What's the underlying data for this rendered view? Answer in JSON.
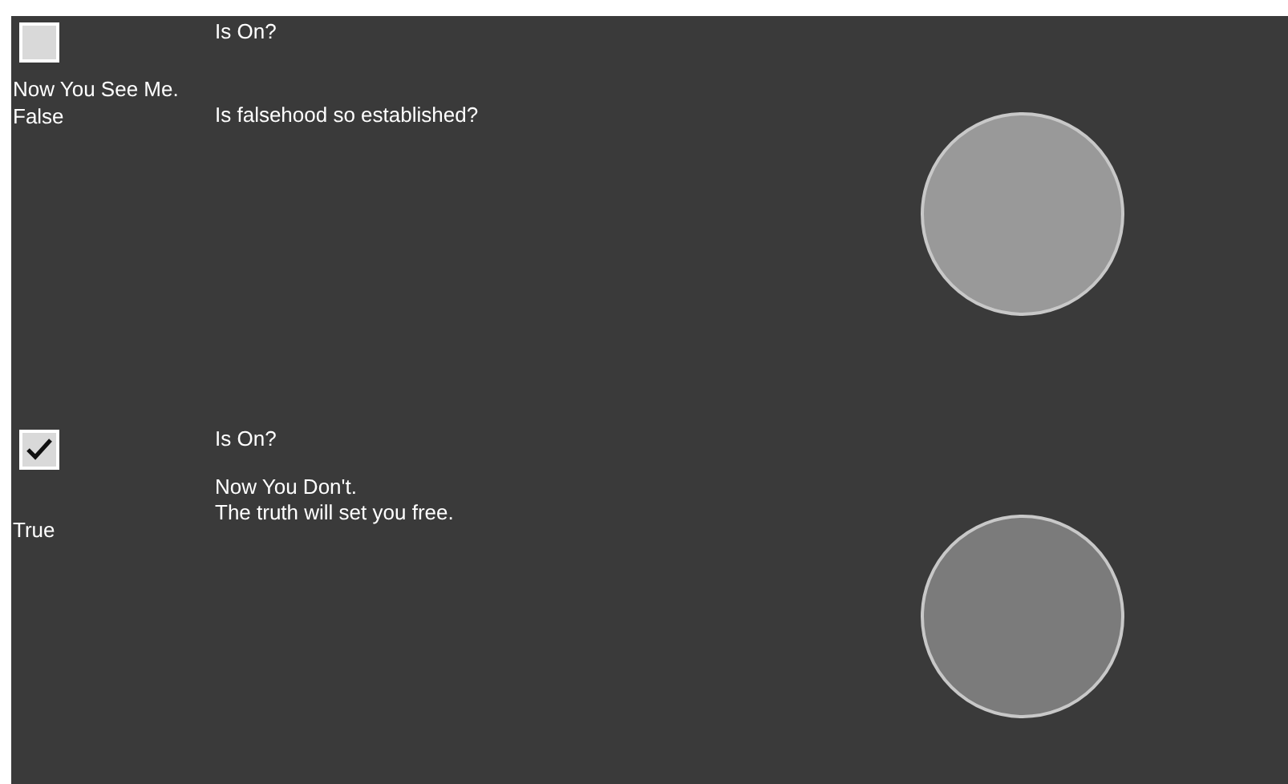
{
  "panels": [
    {
      "kind": "caption-left",
      "checked": false,
      "question": "Is On?",
      "caption": "Now You See Me.",
      "state_text": "False",
      "message": "Is falsehood so established?",
      "color": "#999999"
    },
    {
      "kind": "caption-right",
      "checked": true,
      "question": "Is On?",
      "caption": "Now You Don't.",
      "state_text": "True",
      "message": "The truth will set you free.",
      "color": "#7b7b7b"
    }
  ]
}
